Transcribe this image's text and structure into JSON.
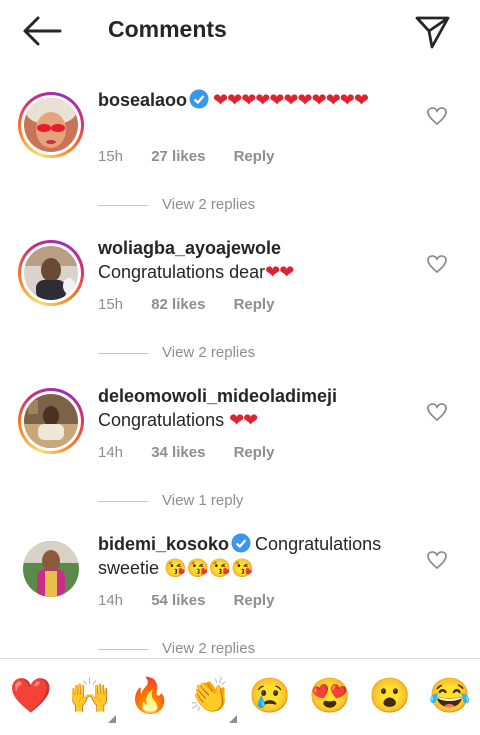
{
  "header": {
    "title": "Comments",
    "back_icon": "arrow-left-icon",
    "send_icon": "paper-plane-icon"
  },
  "comments": [
    {
      "username": "bosealaoo",
      "verified": true,
      "text": "",
      "hearts": "❤❤❤❤❤❤❤❤❤❤❤",
      "time": "15h",
      "likes": "27 likes",
      "reply": "Reply",
      "view_replies": "View 2 replies"
    },
    {
      "username": "woliagba_ayoajewole",
      "verified": false,
      "text": "Congratulations dear",
      "hearts": "❤❤",
      "time": "15h",
      "likes": "82 likes",
      "reply": "Reply",
      "view_replies": "View 2 replies"
    },
    {
      "username": "deleomowoli_mideoladimeji",
      "verified": false,
      "text": "Congratulations ",
      "hearts": "❤❤",
      "time": "14h",
      "likes": "34 likes",
      "reply": "Reply",
      "view_replies": "View 1 reply"
    },
    {
      "username": "bidemi_kosoko",
      "verified": true,
      "text": "Congratulations sweetie 😘😘😘😘",
      "hearts": "",
      "time": "14h",
      "likes": "54 likes",
      "reply": "Reply",
      "view_replies": "View 2 replies"
    }
  ],
  "emoji_bar": [
    "❤️",
    "🙌",
    "🔥",
    "👏",
    "😢",
    "😍",
    "😮",
    "😂"
  ],
  "colors": {
    "heart": "#e0212f",
    "verified": "#3897f0",
    "muted": "#8e8e8e"
  }
}
